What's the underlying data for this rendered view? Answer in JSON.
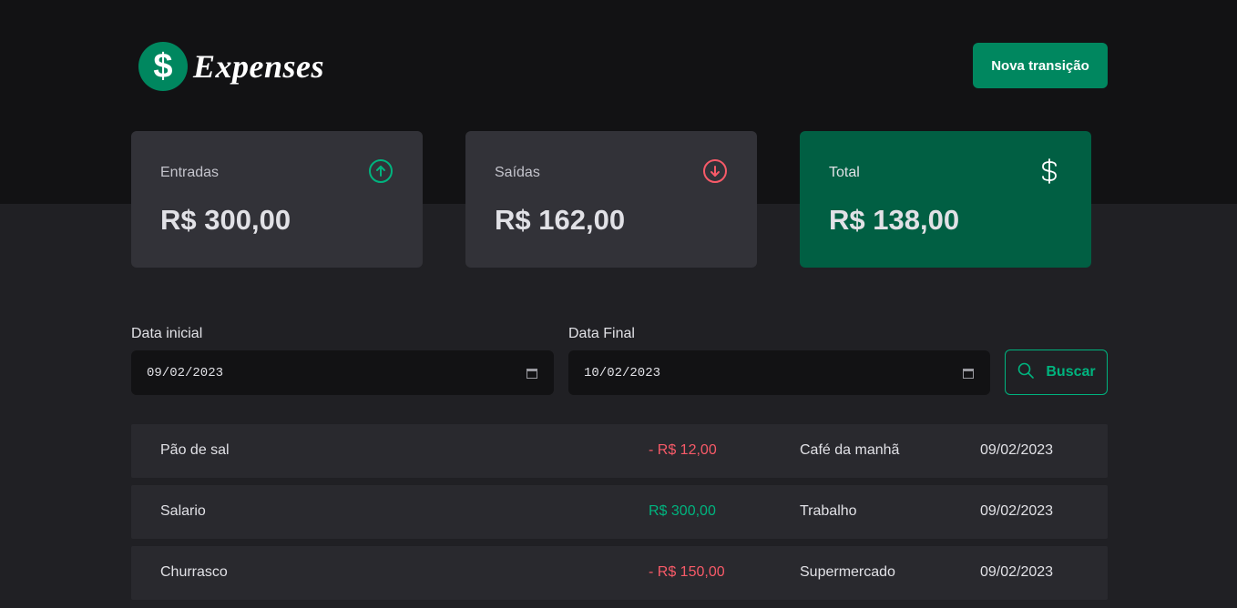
{
  "header": {
    "logo_symbol": "$",
    "logo_text": "Expenses",
    "new_transaction_label": "Nova transição"
  },
  "summary": [
    {
      "label": "Entradas",
      "value": "R$ 300,00",
      "icon": "arrow-circle-up-icon",
      "icon_color": "#00b37e"
    },
    {
      "label": "Saídas",
      "value": "R$ 162,00",
      "icon": "arrow-circle-down-icon",
      "icon_color": "#f75a68"
    },
    {
      "label": "Total",
      "value": "R$ 138,00",
      "icon": "currency-dollar-icon",
      "icon_color": "#ffffff"
    }
  ],
  "filters": {
    "start_label": "Data inicial",
    "start_value": "09/02/2023",
    "end_label": "Data Final",
    "end_value": "10/02/2023",
    "search_label": "Buscar"
  },
  "transactions": [
    {
      "description": "Pão de sal",
      "price": "- R$ 12,00",
      "type": "outcome",
      "category": "Café da manhã",
      "date": "09/02/2023"
    },
    {
      "description": "Salario",
      "price": "R$ 300,00",
      "type": "income",
      "category": "Trabalho",
      "date": "09/02/2023"
    },
    {
      "description": "Churrasco",
      "price": "- R$ 150,00",
      "type": "outcome",
      "category": "Supermercado",
      "date": "09/02/2023"
    }
  ],
  "colors": {
    "brand": "#00875f",
    "brand_light": "#00b37e",
    "danger": "#f75a68",
    "background": "#202024",
    "header_background": "#121214"
  }
}
